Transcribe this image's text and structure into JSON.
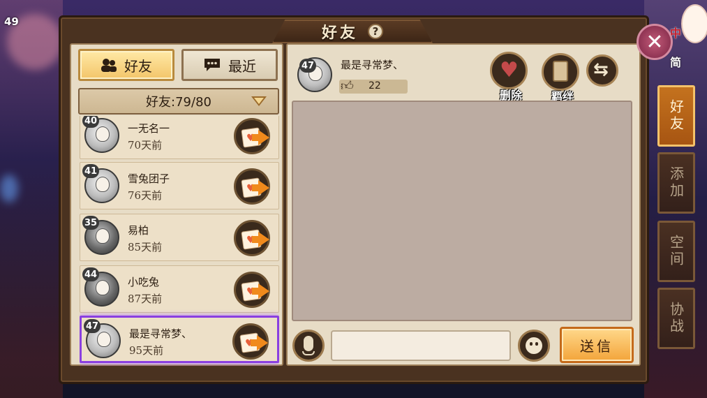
{
  "player": {
    "level": "49"
  },
  "window": {
    "title": "好友",
    "help_icon": "?"
  },
  "left_tabs": {
    "friends": "好友",
    "recent": "最近"
  },
  "friend_count": "好友:79/80",
  "friends": [
    {
      "level": "40",
      "name": "一无名一",
      "last_seen": "70天前"
    },
    {
      "level": "41",
      "name": "雪兔团子",
      "last_seen": "76天前"
    },
    {
      "level": "35",
      "name": "易柏",
      "last_seen": "85天前"
    },
    {
      "level": "44",
      "name": "小吃兔",
      "last_seen": "87天前"
    },
    {
      "level": "47",
      "name": "最是寻常梦、",
      "last_seen": "95天前"
    }
  ],
  "selected": {
    "level": "47",
    "name": "最是寻常梦、",
    "likes": "22"
  },
  "actions": {
    "delete": "删除",
    "bond": "羁绊"
  },
  "chat": {
    "input_value": "",
    "send": "送信"
  },
  "side_tabs": [
    "好友",
    "添加",
    "空间",
    "协战"
  ],
  "corner": {
    "lang_a": "中",
    "lang_b": "简"
  },
  "colors": {
    "selection": "#8a3fe0",
    "accent": "#f3a43a",
    "side_active": "#c4721e"
  },
  "icons": [
    "friends-icon",
    "chat-bubble-icon",
    "dropdown-arrow-icon",
    "send-letter-icon",
    "broken-heart-icon",
    "scroll-icon",
    "swap-icon",
    "microphone-icon",
    "emoji-icon",
    "close-icon",
    "thumbs-up-icon"
  ]
}
